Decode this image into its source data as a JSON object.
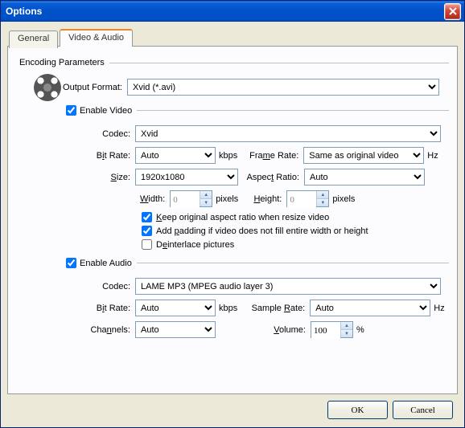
{
  "window": {
    "title": "Options"
  },
  "tabs": {
    "general": "General",
    "video_audio": "Video & Audio"
  },
  "group": {
    "encoding": "Encoding Parameters",
    "enable_video": "Enable Video",
    "enable_audio": "Enable Audio"
  },
  "labels": {
    "output_format": "Output Format:",
    "codec": "Codec:",
    "bit_rate_pre": "B",
    "bit_rate_u": "i",
    "bit_rate_post": "t Rate:",
    "size_pre": "",
    "size_u": "S",
    "size_post": "ize:",
    "frame_rate_pre": "Fra",
    "frame_rate_u": "m",
    "frame_rate_post": "e Rate:",
    "aspect_pre": "Aspec",
    "aspect_u": "t",
    "aspect_post": " Ratio:",
    "width_pre": "",
    "width_u": "W",
    "width_post": "idth:",
    "height_pre": "",
    "height_u": "H",
    "height_post": "eight:",
    "sample_rate_pre": "Sample ",
    "sample_rate_u": "R",
    "sample_rate_post": "ate:",
    "channels_pre": "Cha",
    "channels_u": "n",
    "channels_post": "nels:",
    "volume_pre": "",
    "volume_u": "V",
    "volume_post": "olume:",
    "kbps": "kbps",
    "hz": "Hz",
    "pixels": "pixels",
    "percent": "%"
  },
  "values": {
    "output_format": "Xvid (*.avi)",
    "video_codec": "Xvid",
    "video_bitrate": "Auto",
    "frame_rate": "Same as original video",
    "size": "1920x1080",
    "aspect_ratio": "Auto",
    "width": "0",
    "height": "0",
    "audio_codec": "LAME MP3 (MPEG audio layer 3)",
    "audio_bitrate": "Auto",
    "sample_rate": "Auto",
    "channels": "Auto",
    "volume": "100"
  },
  "checks": {
    "enable_video": true,
    "enable_audio": true,
    "keep_aspect": {
      "checked": true,
      "pre": "",
      "u": "K",
      "post": "eep original aspect ratio when resize video"
    },
    "add_padding": {
      "checked": true,
      "pre": "Add ",
      "u": "p",
      "post": "adding if video does not fill entire width or height"
    },
    "deinterlace": {
      "checked": false,
      "pre": "D",
      "u": "e",
      "post": "interlace pictures"
    }
  },
  "buttons": {
    "ok": "OK",
    "cancel": "Cancel"
  }
}
